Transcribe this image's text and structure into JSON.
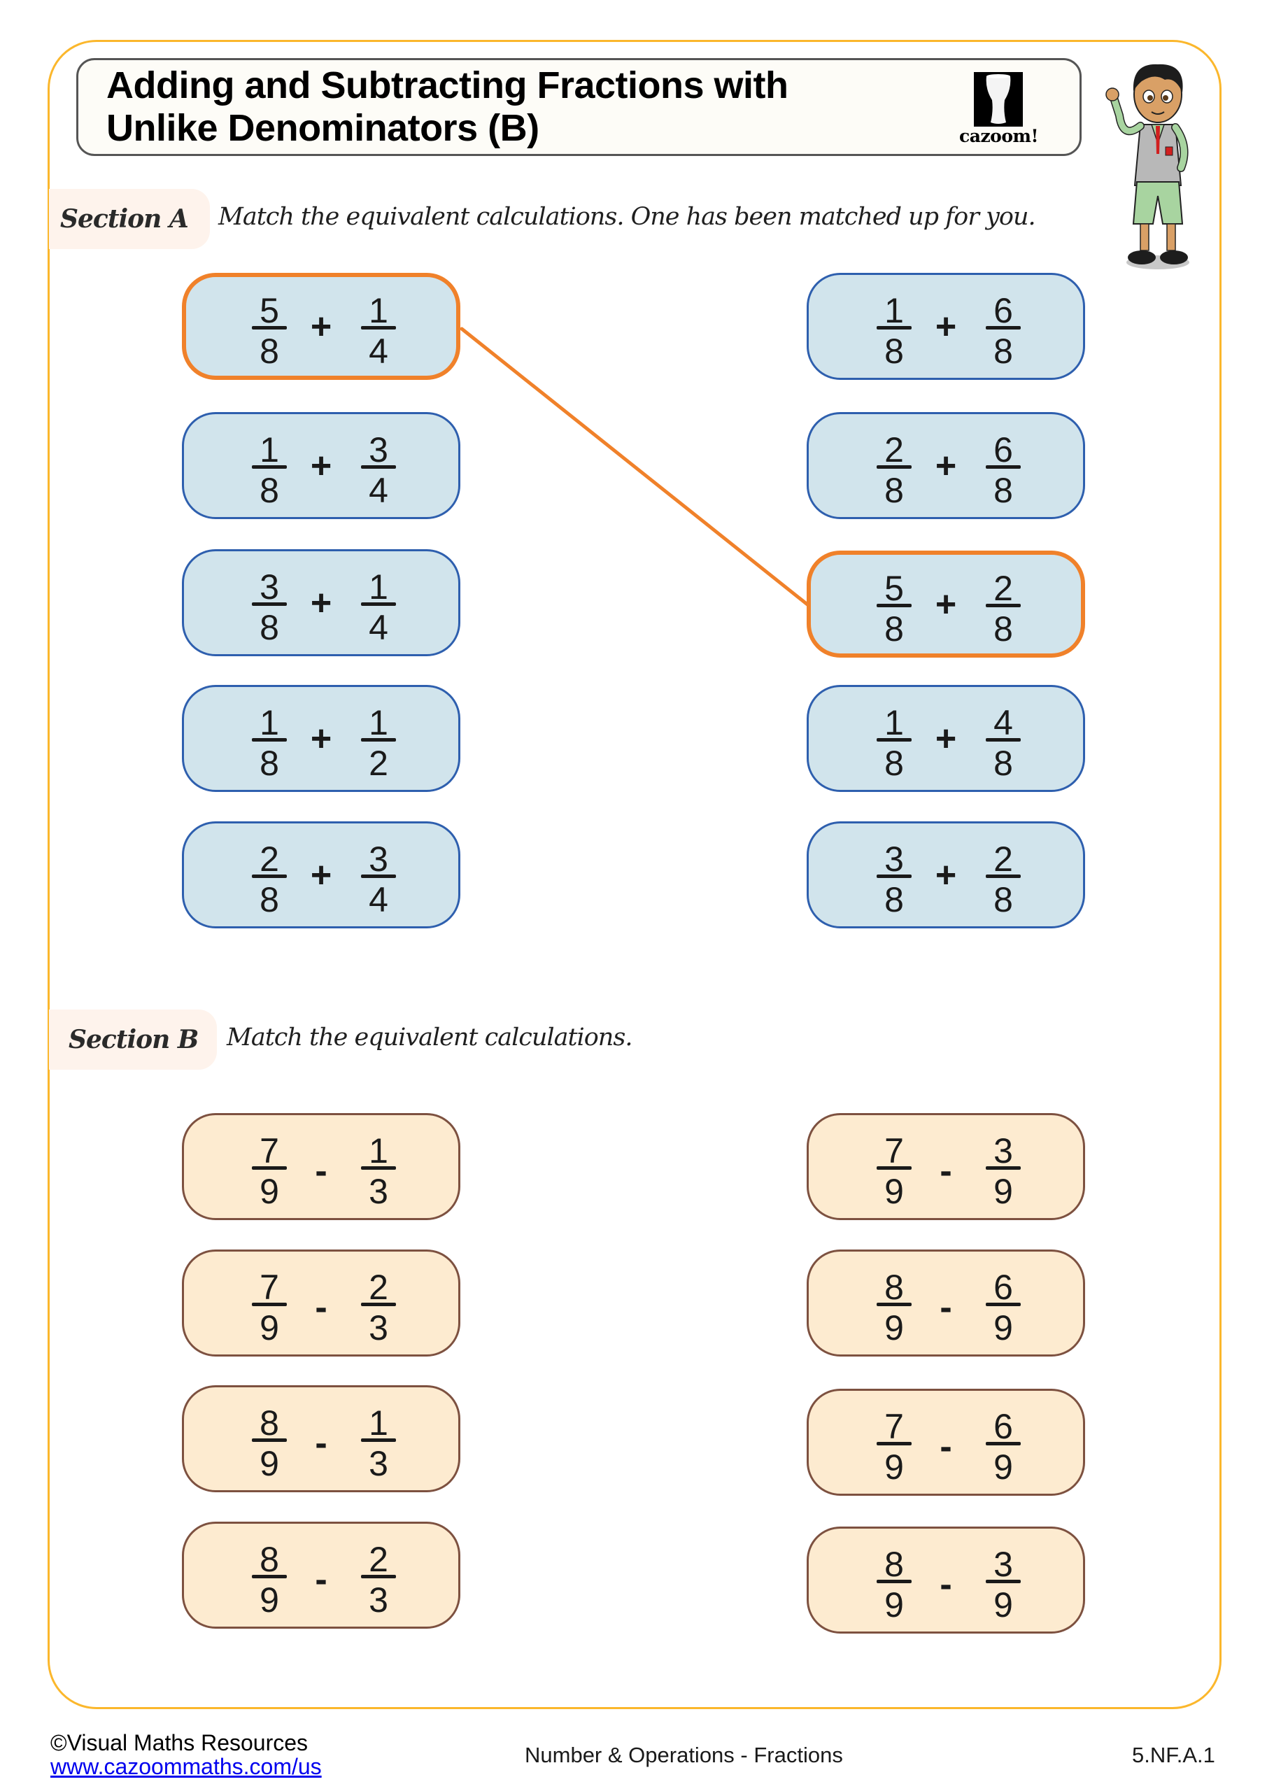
{
  "header": {
    "title_line1": "Adding and Subtracting Fractions with",
    "title_line2": "Unlike Denominators (B)",
    "logo_text": "cazoom!",
    "logo_icon": "drum-icon",
    "mascot": "boy-mascot-waving"
  },
  "sectionA": {
    "label": "Section A",
    "instruction": "Match the equivalent calculations. One has been matched up for you.",
    "operator": "+",
    "left": [
      {
        "a_num": "5",
        "a_den": "8",
        "b_num": "1",
        "b_den": "4",
        "matched": true
      },
      {
        "a_num": "1",
        "a_den": "8",
        "b_num": "3",
        "b_den": "4",
        "matched": false
      },
      {
        "a_num": "3",
        "a_den": "8",
        "b_num": "1",
        "b_den": "4",
        "matched": false
      },
      {
        "a_num": "1",
        "a_den": "8",
        "b_num": "1",
        "b_den": "2",
        "matched": false
      },
      {
        "a_num": "2",
        "a_den": "8",
        "b_num": "3",
        "b_den": "4",
        "matched": false
      }
    ],
    "right": [
      {
        "a_num": "1",
        "a_den": "8",
        "b_num": "6",
        "b_den": "8",
        "matched": false
      },
      {
        "a_num": "2",
        "a_den": "8",
        "b_num": "6",
        "b_den": "8",
        "matched": false
      },
      {
        "a_num": "5",
        "a_den": "8",
        "b_num": "2",
        "b_den": "8",
        "matched": true
      },
      {
        "a_num": "1",
        "a_den": "8",
        "b_num": "4",
        "b_den": "8",
        "matched": false
      },
      {
        "a_num": "3",
        "a_den": "8",
        "b_num": "2",
        "b_den": "8",
        "matched": false
      }
    ],
    "example_match": {
      "left_index": 0,
      "right_index": 2
    }
  },
  "sectionB": {
    "label": "Section B",
    "instruction": "Match the equivalent calculations.",
    "operator": "-",
    "left": [
      {
        "a_num": "7",
        "a_den": "9",
        "b_num": "1",
        "b_den": "3"
      },
      {
        "a_num": "7",
        "a_den": "9",
        "b_num": "2",
        "b_den": "3"
      },
      {
        "a_num": "8",
        "a_den": "9",
        "b_num": "1",
        "b_den": "3"
      },
      {
        "a_num": "8",
        "a_den": "9",
        "b_num": "2",
        "b_den": "3"
      }
    ],
    "right": [
      {
        "a_num": "7",
        "a_den": "9",
        "b_num": "3",
        "b_den": "9"
      },
      {
        "a_num": "8",
        "a_den": "9",
        "b_num": "6",
        "b_den": "9"
      },
      {
        "a_num": "7",
        "a_den": "9",
        "b_num": "6",
        "b_den": "9"
      },
      {
        "a_num": "8",
        "a_den": "9",
        "b_num": "3",
        "b_den": "9"
      }
    ]
  },
  "colors": {
    "frame": "#fbb72c",
    "sectionA_fill": "#d1e4ec",
    "sectionA_border": "#2e5fae",
    "sectionB_fill": "#fdebd0",
    "sectionB_border": "#7d5140",
    "match_highlight": "#f0812a",
    "section_label_bg": "#fef3ec"
  },
  "footer": {
    "copyright": "©Visual Maths Resources",
    "link": "www.cazoommaths.com/us",
    "topic": "Number & Operations - Fractions",
    "standard": "5.NF.A.1"
  }
}
